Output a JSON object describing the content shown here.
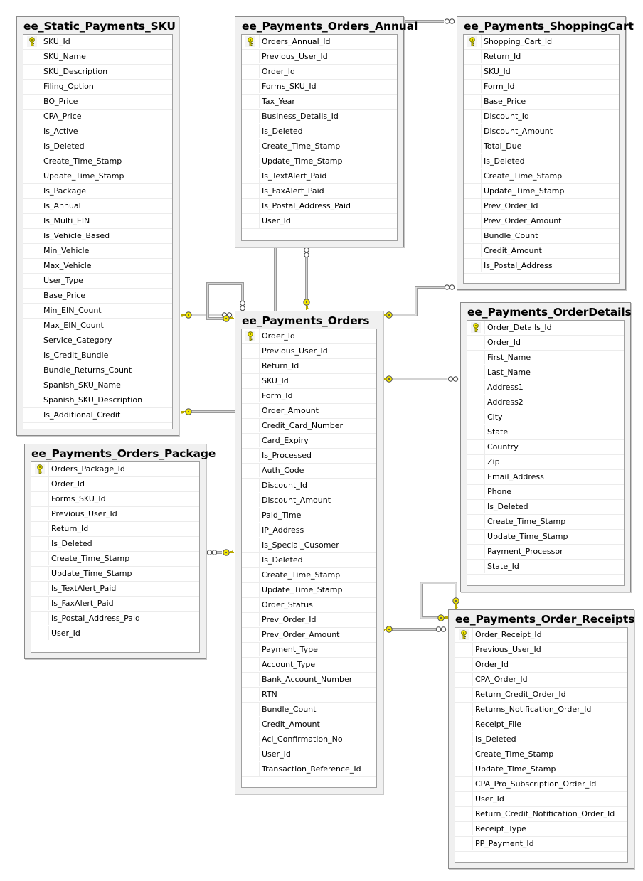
{
  "diagram": {
    "type": "database-schema",
    "tables": [
      {
        "id": "sku",
        "name": "ee_Static_Payments_SKU",
        "primary_key": "SKU_Id",
        "columns": [
          "SKU_Id",
          "SKU_Name",
          "SKU_Description",
          "Filing_Option",
          "BO_Price",
          "CPA_Price",
          "Is_Active",
          "Is_Deleted",
          "Create_Time_Stamp",
          "Update_Time_Stamp",
          "Is_Package",
          "Is_Annual",
          "Is_Multi_EIN",
          "Is_Vehicle_Based",
          "Min_Vehicle",
          "Max_Vehicle",
          "User_Type",
          "Base_Price",
          "Min_EIN_Count",
          "Max_EIN_Count",
          "Service_Category",
          "Is_Credit_Bundle",
          "Bundle_Returns_Count",
          "Spanish_SKU_Name",
          "Spanish_SKU_Description",
          "Is_Additional_Credit"
        ]
      },
      {
        "id": "annual",
        "name": "ee_Payments_Orders_Annual",
        "primary_key": "Orders_Annual_Id",
        "columns": [
          "Orders_Annual_Id",
          "Previous_User_Id",
          "Order_Id",
          "Forms_SKU_Id",
          "Tax_Year",
          "Business_Details_Id",
          "Is_Deleted",
          "Create_Time_Stamp",
          "Update_Time_Stamp",
          "Is_TextAlert_Paid",
          "Is_FaxAlert_Paid",
          "Is_Postal_Address_Paid",
          "User_Id"
        ]
      },
      {
        "id": "cart",
        "name": "ee_Payments_ShoppingCart",
        "primary_key": "Shopping_Cart_Id",
        "columns": [
          "Shopping_Cart_Id",
          "Return_Id",
          "SKU_Id",
          "Form_Id",
          "Base_Price",
          "Discount_Id",
          "Discount_Amount",
          "Total_Due",
          "Is_Deleted",
          "Create_Time_Stamp",
          "Update_Time_Stamp",
          "Prev_Order_Id",
          "Prev_Order_Amount",
          "Bundle_Count",
          "Credit_Amount",
          "Is_Postal_Address"
        ]
      },
      {
        "id": "orders",
        "name": "ee_Payments_Orders",
        "primary_key": "Order_Id",
        "columns": [
          "Order_Id",
          "Previous_User_Id",
          "Return_Id",
          "SKU_Id",
          "Form_Id",
          "Order_Amount",
          "Credit_Card_Number",
          "Card_Expiry",
          "Is_Processed",
          "Auth_Code",
          "Discount_Id",
          "Discount_Amount",
          "Paid_Time",
          "IP_Address",
          "Is_Special_Cusomer",
          "Is_Deleted",
          "Create_Time_Stamp",
          "Update_Time_Stamp",
          "Order_Status",
          "Prev_Order_Id",
          "Prev_Order_Amount",
          "Payment_Type",
          "Account_Type",
          "Bank_Account_Number",
          "RTN",
          "Bundle_Count",
          "Credit_Amount",
          "Aci_Confirmation_No",
          "User_Id",
          "Transaction_Reference_Id"
        ]
      },
      {
        "id": "details",
        "name": "ee_Payments_OrderDetails",
        "primary_key": "Order_Details_Id",
        "columns": [
          "Order_Details_Id",
          "Order_Id",
          "First_Name",
          "Last_Name",
          "Address1",
          "Address2",
          "City",
          "State",
          "Country",
          "Zip",
          "Email_Address",
          "Phone",
          "Is_Deleted",
          "Create_Time_Stamp",
          "Update_Time_Stamp",
          "Payment_Processor",
          "State_Id"
        ]
      },
      {
        "id": "package",
        "name": "ee_Payments_Orders_Package",
        "primary_key": "Orders_Package_Id",
        "columns": [
          "Orders_Package_Id",
          "Order_Id",
          "Forms_SKU_Id",
          "Previous_User_Id",
          "Return_Id",
          "Is_Deleted",
          "Create_Time_Stamp",
          "Update_Time_Stamp",
          "Is_TextAlert_Paid",
          "Is_FaxAlert_Paid",
          "Is_Postal_Address_Paid",
          "User_Id"
        ]
      },
      {
        "id": "receipts",
        "name": "ee_Payments_Order_Receipts",
        "primary_key": "Order_Receipt_Id",
        "columns": [
          "Order_Receipt_Id",
          "Previous_User_Id",
          "Order_Id",
          "CPA_Order_Id",
          "Return_Credit_Order_Id",
          "Returns_Notification_Order_Id",
          "Receipt_File",
          "Is_Deleted",
          "Create_Time_Stamp",
          "Update_Time_Stamp",
          "CPA_Pro_Subscription_Order_Id",
          "User_Id",
          "Return_Credit_Notification_Order_Id",
          "Receipt_Type",
          "PP_Payment_Id"
        ]
      }
    ],
    "relationships": [
      {
        "from": "sku",
        "to": "orders",
        "one_end": "sku",
        "many_end": "orders"
      },
      {
        "from": "sku",
        "to": "orders",
        "one_end": "sku",
        "many_end": "orders"
      },
      {
        "from": "orders",
        "to": "orders",
        "self_reference": true
      },
      {
        "from": "orders",
        "to": "annual",
        "one_end": "orders",
        "many_end": "annual"
      },
      {
        "from": "annual",
        "to": "cart",
        "many_end": "cart"
      },
      {
        "from": "orders",
        "to": "cart",
        "one_end": "orders",
        "many_end": "cart"
      },
      {
        "from": "orders",
        "to": "details",
        "one_end": "orders",
        "many_end": "details"
      },
      {
        "from": "orders",
        "to": "package",
        "one_end": "orders",
        "many_end": "package"
      },
      {
        "from": "orders",
        "to": "receipts",
        "one_end": "orders",
        "many_end": "receipts"
      },
      {
        "from": "receipts",
        "to": "receipts",
        "self_reference": true
      }
    ],
    "colors": {
      "key_icon": "#f2e600",
      "table_frame": "#f0f0f0",
      "line": "#9a9a9a"
    }
  }
}
